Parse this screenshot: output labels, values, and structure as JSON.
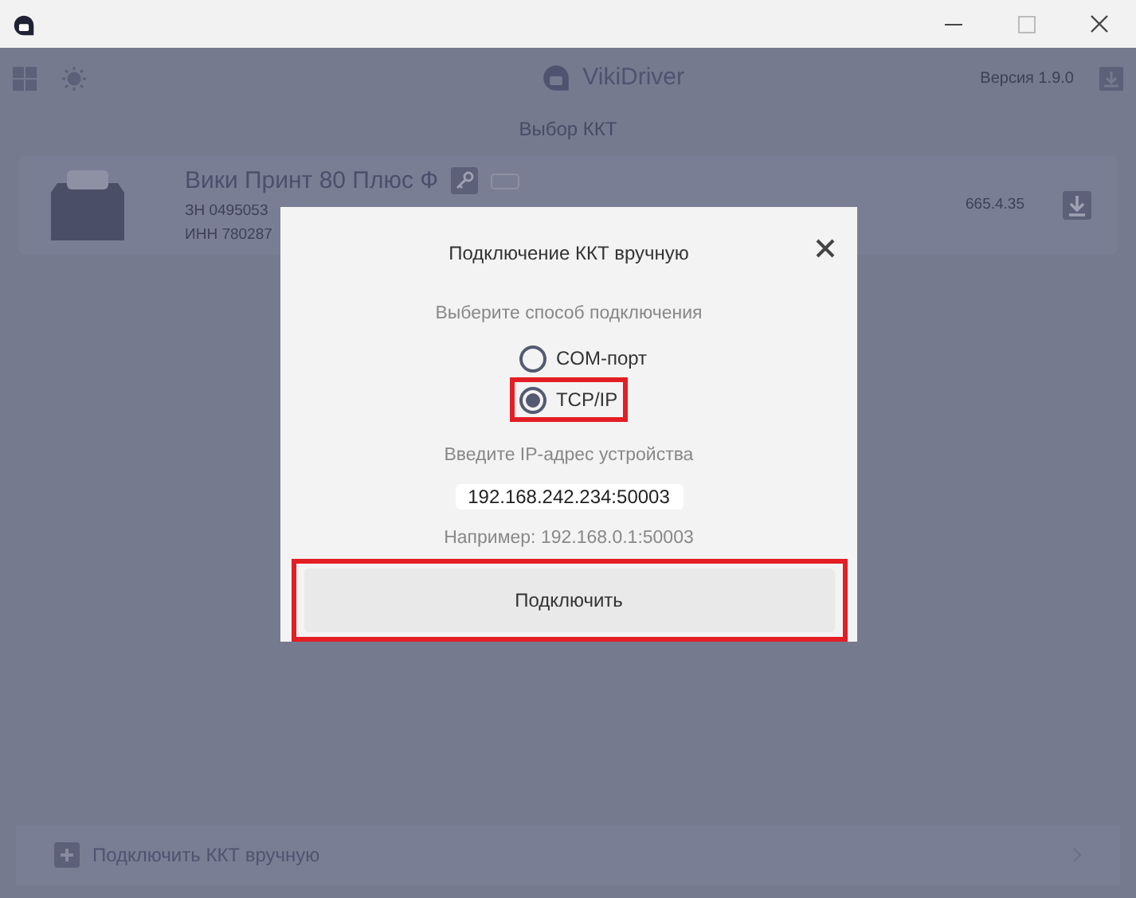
{
  "header": {
    "app_name": "VikiDriver",
    "version": "Версия 1.9.0"
  },
  "page_title": "Выбор ККТ",
  "devices": [
    {
      "name": "Вики Принт 80 Плюс Ф",
      "serial": "ЗН  0495053",
      "inn": "ИНН  780287",
      "firmware": "665.4.35"
    }
  ],
  "bottom_bar": {
    "label": "Подключить ККТ вручную"
  },
  "dialog": {
    "title": "Подключение ККТ вручную",
    "method_label": "Выберите способ подключения",
    "options": [
      {
        "label": "COM-порт",
        "selected": false,
        "highlighted": false
      },
      {
        "label": "TCP/IP",
        "selected": true,
        "highlighted": true
      }
    ],
    "ip_label": "Введите IP-адрес устройства",
    "ip_value": "192.168.242.234:50003",
    "example": "Например: 192.168.0.1:50003",
    "connect_button": {
      "label": "Подключить",
      "highlighted": true
    }
  }
}
